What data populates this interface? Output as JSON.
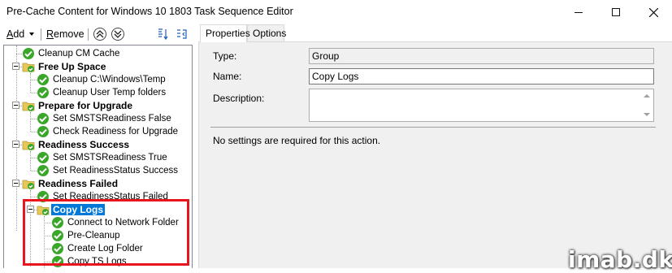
{
  "window": {
    "title": "Pre-Cache Content for Windows 10 1803 Task Sequence Editor",
    "minimize_icon": "minimize-icon",
    "maximize_icon": "maximize-icon",
    "close_icon": "close-icon"
  },
  "toolbar": {
    "add_accel": "A",
    "add_rest": "dd",
    "remove_accel": "R",
    "remove_rest": "emove",
    "move_up_icon": "move-up-icon",
    "move_down_icon": "move-down-icon"
  },
  "tree": {
    "items": [
      {
        "label": "Cleanup CM Cache",
        "type": "step"
      },
      {
        "label": "Free Up Space",
        "type": "group"
      },
      {
        "label": "Cleanup C:\\Windows\\Temp",
        "type": "step"
      },
      {
        "label": "Cleanup User Temp folders",
        "type": "step"
      },
      {
        "label": "Prepare for Upgrade",
        "type": "group"
      },
      {
        "label": "Set SMSTSReadiness False",
        "type": "step"
      },
      {
        "label": "Check Readiness for Upgrade",
        "type": "step"
      },
      {
        "label": "Readiness Success",
        "type": "group"
      },
      {
        "label": "Set SMSTSReadiness True",
        "type": "step"
      },
      {
        "label": "Set ReadinessStatus Success",
        "type": "step"
      },
      {
        "label": "Readiness Failed",
        "type": "group"
      },
      {
        "label": "Set ReadinessStatus Failed",
        "type": "step"
      },
      {
        "label": "Copy Logs",
        "type": "group",
        "selected": true
      },
      {
        "label": "Connect to Network Folder",
        "type": "step"
      },
      {
        "label": "Pre-Cleanup",
        "type": "step"
      },
      {
        "label": "Create Log Folder",
        "type": "step"
      },
      {
        "label": "Copy TS Logs",
        "type": "step"
      }
    ]
  },
  "tabs": [
    {
      "label": "Properties",
      "active": true
    },
    {
      "label": "Options",
      "active": false
    }
  ],
  "properties": {
    "type_label": "Type:",
    "type_value": "Group",
    "name_label": "Name:",
    "name_value": "Copy Logs",
    "description_label": "Description:",
    "description_value": "",
    "no_settings_text": "No settings are required  for this action."
  },
  "watermark": "imab.dk",
  "colors": {
    "selection": "#0078d7",
    "highlight_border": "#e8141e",
    "check_green": "#3aa72b",
    "folder_yellow": "#e8c85a"
  }
}
